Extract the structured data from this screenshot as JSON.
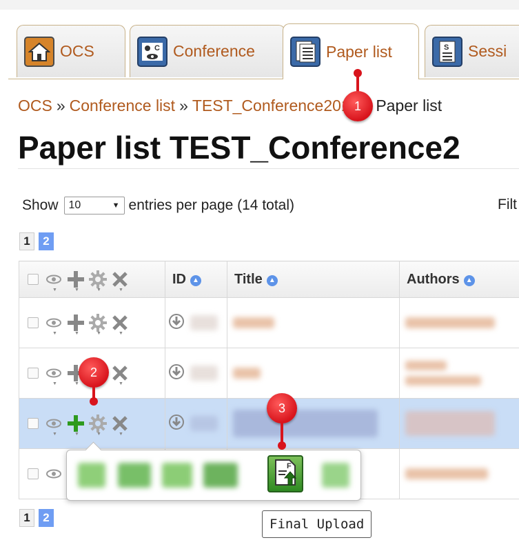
{
  "tabs": [
    {
      "label": "OCS",
      "icon": "house-icon"
    },
    {
      "label": "Conference",
      "icon": "conference-icon"
    },
    {
      "label": "Paper list",
      "icon": "paper-list-icon",
      "active": true
    },
    {
      "label": "Sessi",
      "icon": "session-icon"
    }
  ],
  "breadcrumb": {
    "items": [
      "OCS",
      "Conference list",
      "TEST_Conference2019"
    ],
    "current": "Paper list",
    "separator": "»"
  },
  "page_title": "Paper list TEST_Conference2",
  "entries": {
    "show_label": "Show",
    "per_page_value": "10",
    "suffix_label": "entries per page (14 total)",
    "filter_label": "Filt"
  },
  "pagination": {
    "current": "1",
    "next": "2"
  },
  "table": {
    "columns": {
      "id": "ID",
      "title": "Title",
      "authors": "Authors"
    },
    "rows": [
      {
        "highlight": false
      },
      {
        "highlight": false
      },
      {
        "highlight": true
      },
      {
        "highlight": false
      }
    ]
  },
  "popup": {
    "final_upload_tooltip": "Final Upload"
  },
  "markers": [
    "1",
    "2",
    "3"
  ],
  "colors": {
    "link": "#b05a1e",
    "highlight_row": "#c9ddf6",
    "pager_active": "#6f9df3",
    "marker_red": "#d8141c",
    "add_green": "#2e9a1e"
  }
}
